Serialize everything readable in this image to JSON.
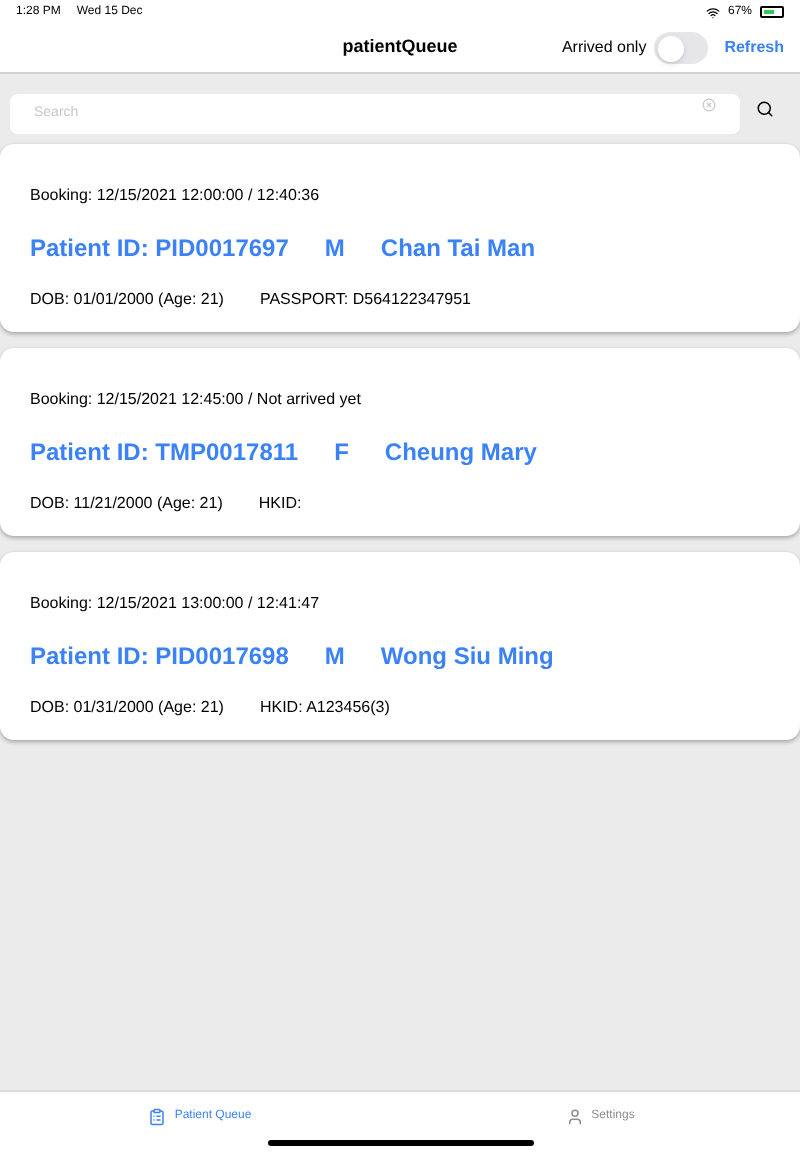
{
  "status_bar": {
    "time": "1:28 PM",
    "date": "Wed 15 Dec",
    "battery": "67%"
  },
  "nav": {
    "title": "patientQueue",
    "filter_label": "Arrived only",
    "filter_on": false,
    "refresh": "Refresh"
  },
  "search": {
    "placeholder": "Search"
  },
  "patients": [
    {
      "booking": "Booking: 12/15/2021 12:00:00 / 12:40:36",
      "patient_id": "Patient ID: PID0017697",
      "sex": "M",
      "name": "Chan Tai Man",
      "dob": "DOB: 01/01/2000 (Age: 21)",
      "document": "PASSPORT: D564122347951"
    },
    {
      "booking": "Booking: 12/15/2021 12:45:00 / Not arrived yet",
      "patient_id": "Patient ID: TMP0017811",
      "sex": "F",
      "name": "Cheung Mary",
      "dob": "DOB: 11/21/2000 (Age: 21)",
      "document": "HKID:"
    },
    {
      "booking": "Booking: 12/15/2021 13:00:00 / 12:41:47",
      "patient_id": "Patient ID: PID0017698",
      "sex": "M",
      "name": "Wong Siu Ming",
      "dob": "DOB: 01/31/2000 (Age: 21)",
      "document": "HKID: A123456(3)"
    }
  ],
  "tabs": [
    {
      "label": "Patient Queue",
      "kind": "queue",
      "selected": true
    },
    {
      "label": "Settings",
      "kind": "person",
      "selected": false
    }
  ]
}
